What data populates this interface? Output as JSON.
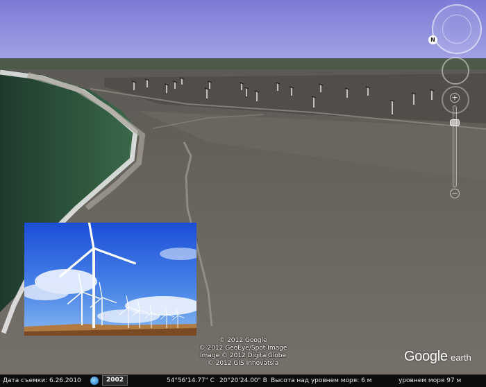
{
  "imagery": {
    "capture_date_label": "Дата съемки: 6.26.2010",
    "year_label": "2002"
  },
  "navigation": {
    "north_label": "N",
    "zoom_in": "+",
    "zoom_out": "−"
  },
  "attribution": [
    "© 2012 Google",
    "© 2012 GeoEye/Spot Image",
    "Image © 2012 DigitalGlobe",
    "© 2012 GIS Innovatsia"
  ],
  "logo": {
    "brand": "Google",
    "product": "earth"
  },
  "status": {
    "latitude": "54°56'14.77\" С",
    "longitude": "20°20'24.00\" В",
    "elevation": "Высота над уровнем моря: 6 м",
    "eye_altitude": "уровнем моря 97 м"
  },
  "colors": {
    "sky": "#8b8bdc",
    "sea": "#2f5a3e",
    "land": "#6f6a64",
    "status_bar": "#0c0c0c"
  }
}
